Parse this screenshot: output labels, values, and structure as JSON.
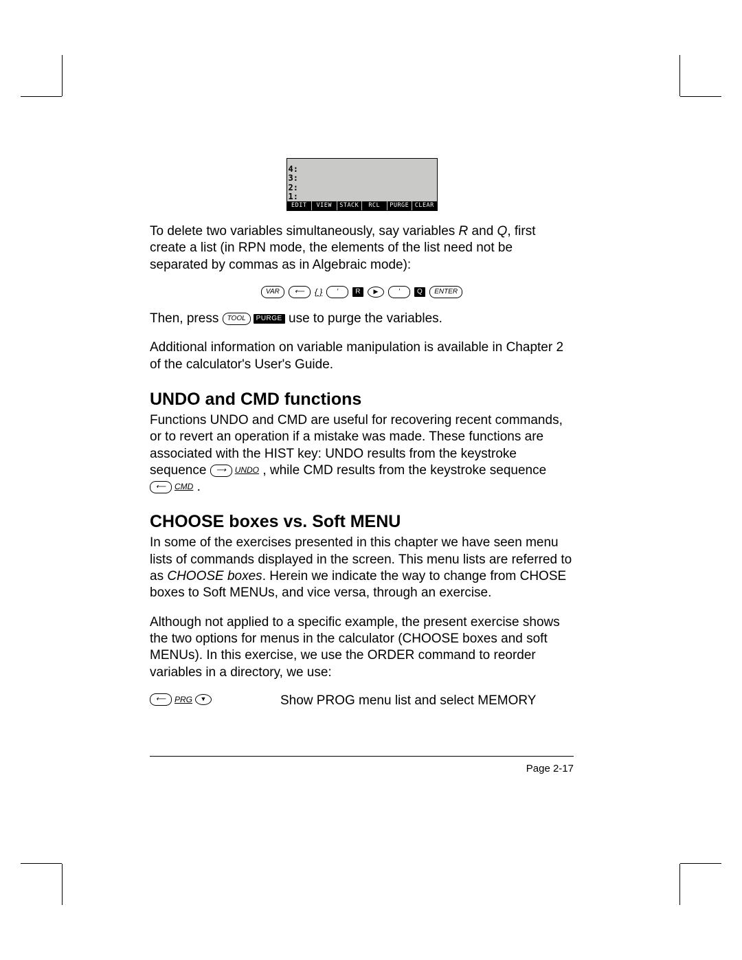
{
  "calc_screen": {
    "stack": [
      "4:",
      "3:",
      "2:",
      "1:"
    ],
    "menu": [
      "EDIT",
      "VIEW",
      "STACK",
      "RCL",
      "PURGE",
      "CLEAR"
    ]
  },
  "para1_a": "To delete two variables simultaneously, say variables ",
  "para1_R": "R",
  "para1_b": " and ",
  "para1_Q": "Q",
  "para1_c": ", first create a list (in RPN mode, the elements of the list need not be separated by commas as in Algebraic mode):",
  "keyrow1": {
    "var": "VAR",
    "left": "⟵",
    "brace": "{ }",
    "apos1": "′",
    "soft_r": "R",
    "apos2": "′",
    "soft_q": "Q",
    "enter": "ENTER"
  },
  "para2_a": "Then, press ",
  "para2_key_tool": "TOOL",
  "para2_soft_purge": "PURGE",
  "para2_b": " use to purge the variables.",
  "para3": "Additional information on variable manipulation is available in Chapter 2 of the calculator's User's Guide.",
  "h_undo": "UNDO and CMD functions",
  "para4_a": "Functions UNDO and CMD are useful for recovering recent commands, or to revert an operation if a mistake was made.  These functions are associated with the HIST key: UNDO results from the keystroke sequence ",
  "para4_right": "⟶",
  "para4_undo": "UNDO",
  "para4_b": " , while CMD results from the keystroke sequence ",
  "para4_left": "⟵",
  "para4_cmd": "CMD",
  "para4_c": " .",
  "h_choose": "CHOOSE boxes vs. Soft MENU",
  "para5_a": "In some of the exercises presented in this chapter we have seen menu lists of commands displayed in the screen.  This menu lists are referred to as ",
  "para5_term": "CHOOSE boxes",
  "para5_b": ".  Herein we indicate the way to change from CHOSE boxes to Soft MENUs, and vice versa, through an exercise.",
  "para6": "Although not applied to a specific example, the present exercise shows the two options for menus in the calculator (CHOOSE boxes and soft MENUs).  In this exercise, we use the ORDER command to reorder variables in a directory, we use:",
  "step1": {
    "left": "⟵",
    "prg": "PRG",
    "desc": "Show PROG menu list and select MEMORY"
  },
  "page_num": "Page 2-17"
}
